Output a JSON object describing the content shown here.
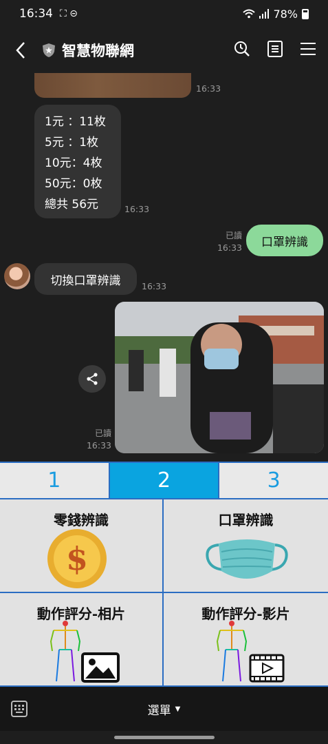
{
  "status_bar": {
    "time": "16:34",
    "indicators": "⛶ ⊝",
    "battery": "78%"
  },
  "header": {
    "title": "智慧物聯網"
  },
  "chat": {
    "image_time": "16:33",
    "coin_lines": [
      "1元 ：11枚",
      "5元 ：1枚",
      "10元：4枚",
      "50元：0枚",
      "總共 56元"
    ],
    "coin_time": "16:33",
    "out_read": "已讀",
    "out_time": "16:33",
    "out_text": "口罩辨識",
    "switch_text": "切換口罩辨識",
    "switch_time": "16:33",
    "photo_read": "已讀",
    "photo_time": "16:33"
  },
  "menu": {
    "tabs": [
      {
        "label": "1"
      },
      {
        "label": "2"
      },
      {
        "label": "3"
      }
    ],
    "active_tab": "2",
    "cells": [
      {
        "label": "零錢辨識"
      },
      {
        "label": "口罩辨識"
      },
      {
        "label": "動作評分-相片"
      },
      {
        "label": "動作評分-影片"
      }
    ]
  },
  "bottom": {
    "menu_label": "選單"
  },
  "colors": {
    "accent": "#0aa4e0",
    "outgoing_bubble": "#8cd99a",
    "border": "#2a6dc2"
  }
}
